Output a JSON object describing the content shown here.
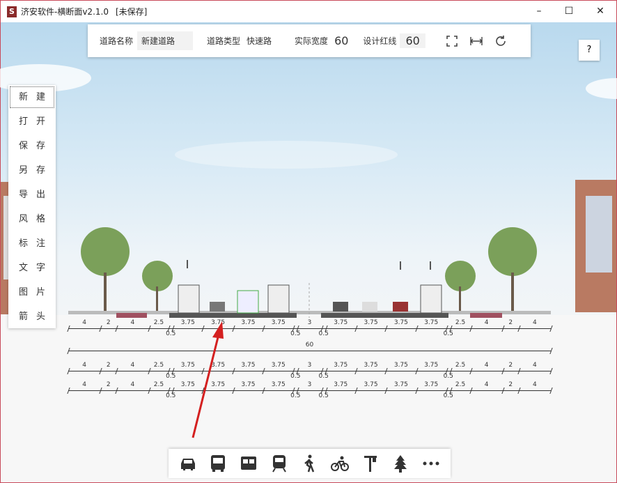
{
  "window": {
    "title": "济安软件-横断面v2.1.0",
    "status": "[未保存]",
    "logo": "S"
  },
  "topbar": {
    "road_name_label": "道路名称",
    "road_name_value": "新建道路",
    "road_type_label": "道路类型",
    "road_type_value": "快速路",
    "actual_width_label": "实际宽度",
    "actual_width_value": "60",
    "design_red_line_label": "设计红线",
    "design_red_line_value": "60"
  },
  "help": "?",
  "menu": [
    {
      "label": "新建"
    },
    {
      "label": "打开"
    },
    {
      "label": "保存"
    },
    {
      "label": "另存"
    },
    {
      "label": "导出"
    },
    {
      "label": "风格"
    },
    {
      "label": "标注"
    },
    {
      "label": "文字"
    },
    {
      "label": "图片"
    },
    {
      "label": "箭头"
    }
  ],
  "dimensions": {
    "segments": [
      "4",
      "2",
      "4",
      "2.5",
      "0.5",
      "3.75",
      "3.75",
      "3.75",
      "3.75",
      "0.5",
      "3",
      "0.5",
      "3.75",
      "3.75",
      "3.75",
      "3.75",
      "0.5",
      "2.5",
      "4",
      "2",
      "4"
    ],
    "total": "60"
  },
  "bottom_tools": [
    "car-icon",
    "bus-icon",
    "tram-icon",
    "train-icon",
    "pedestrian-icon",
    "bicycle-icon",
    "street-light-icon",
    "tree-icon",
    "more-icon"
  ]
}
